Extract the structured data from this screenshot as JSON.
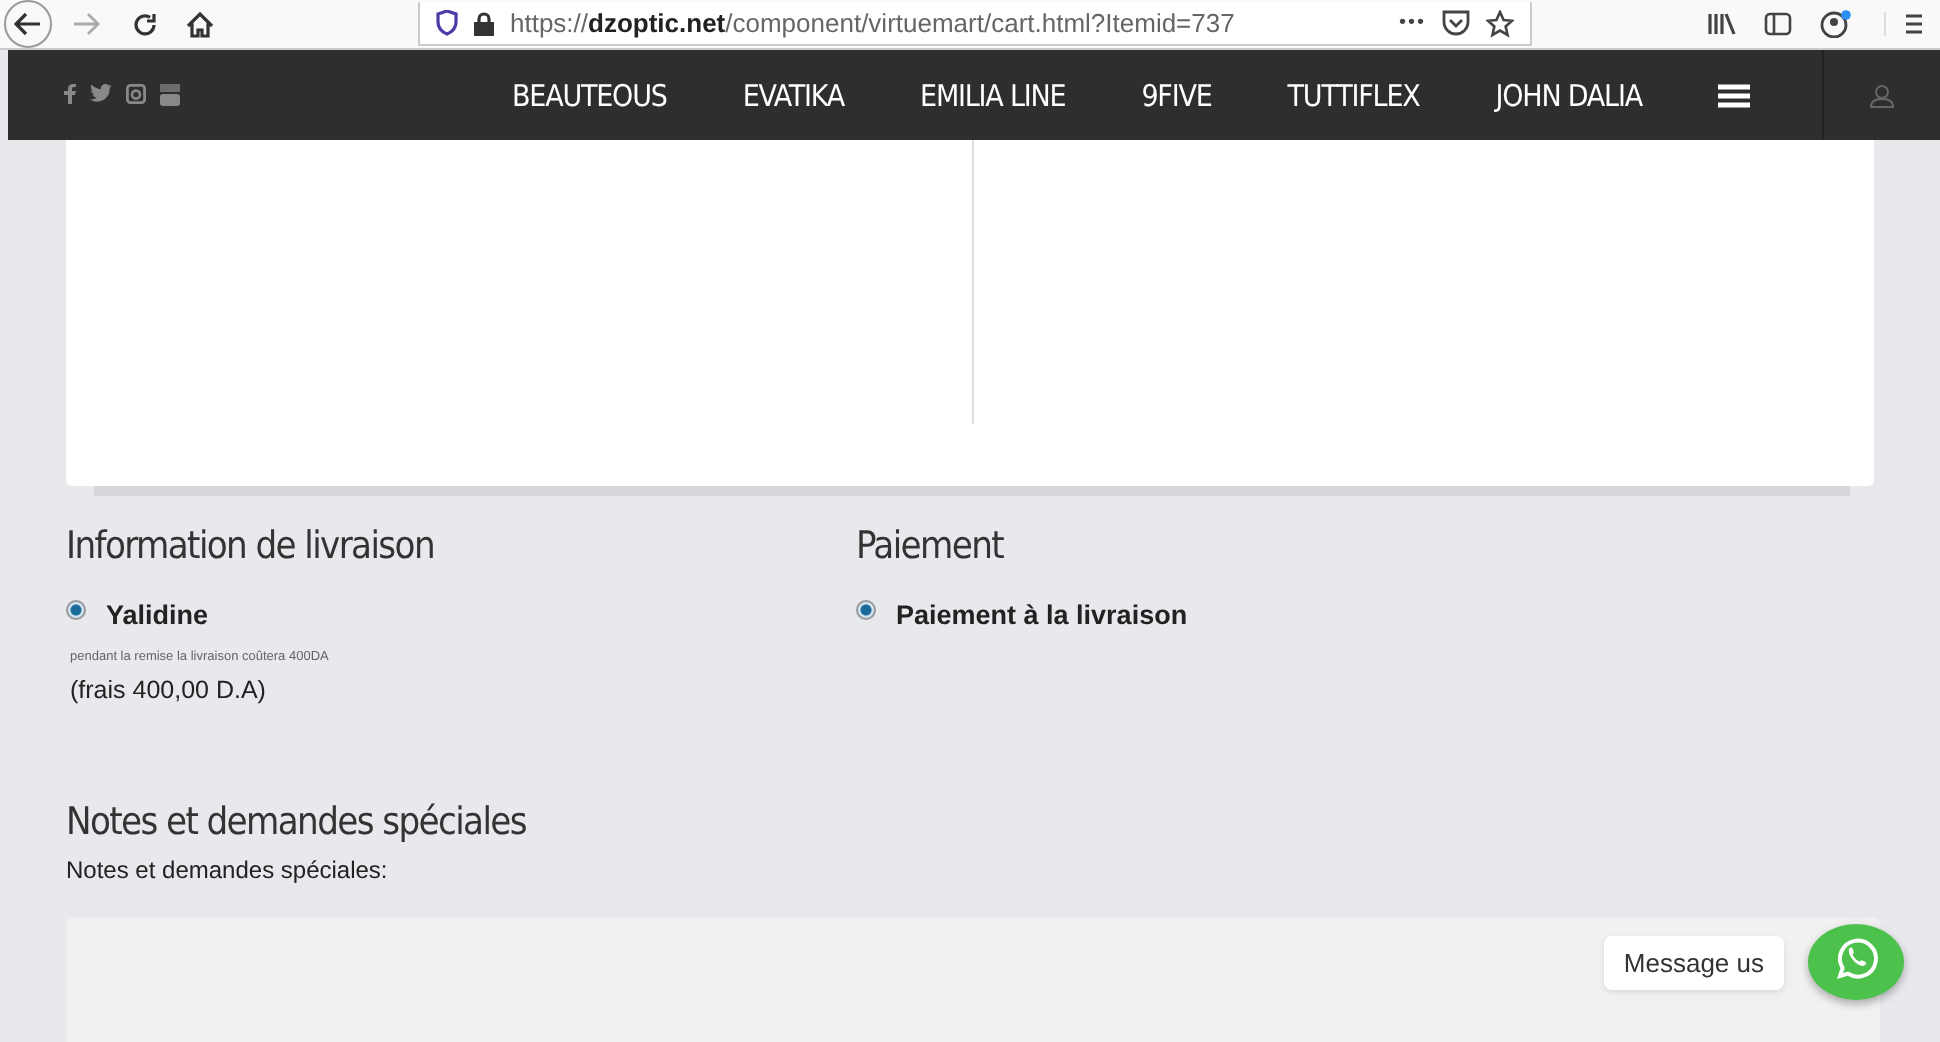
{
  "browser": {
    "url": "https://**dzoptic.net**/component/virtuemart/cart.html?Itemid=737",
    "page_actions": "•••"
  },
  "nav": {
    "items": [
      {
        "label": "BEAUTEOUS"
      },
      {
        "label": "EVATIKA"
      },
      {
        "label": "EMILIA LINE"
      },
      {
        "label": "9FIVE"
      },
      {
        "label": "TUTTIFLEX"
      },
      {
        "label": "JOHN DALIA"
      }
    ]
  },
  "shipping": {
    "title": "Information de livraison",
    "options": [
      {
        "label": "Yalidine",
        "selected": true,
        "description": "pendant la remise la livraison coûtera 400DA",
        "fee": "(frais 400,00 D.A)"
      }
    ]
  },
  "payment": {
    "title": "Paiement",
    "options": [
      {
        "label": "Paiement à la livraison",
        "selected": true
      }
    ]
  },
  "notes": {
    "title": "Notes et demandes spéciales",
    "label": "Notes et demandes spéciales:"
  },
  "chat": {
    "label": "Message us"
  }
}
